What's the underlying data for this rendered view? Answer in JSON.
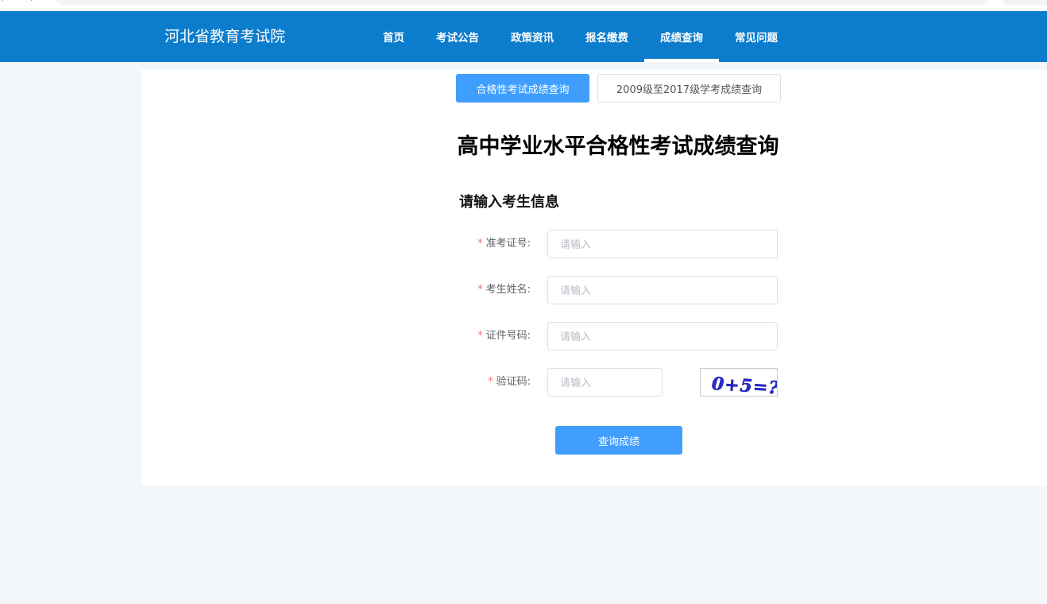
{
  "header": {
    "site_title": "河北省教育考试院",
    "nav": [
      {
        "label": "首页",
        "active": false
      },
      {
        "label": "考试公告",
        "active": false
      },
      {
        "label": "政策资讯",
        "active": false
      },
      {
        "label": "报名缴费",
        "active": false
      },
      {
        "label": "成绩查询",
        "active": true
      },
      {
        "label": "常见问题",
        "active": false
      }
    ]
  },
  "tabs": {
    "primary_label": "合格性考试成绩查询",
    "secondary_label": "2009级至2017级学考成绩查询"
  },
  "main": {
    "title": "高中学业水平合格性考试成绩查询",
    "section_title": "请输入考生信息"
  },
  "form": {
    "required_mark": "*",
    "fields": [
      {
        "label": "准考证号:",
        "placeholder": "请输入",
        "value": ""
      },
      {
        "label": "考生姓名:",
        "placeholder": "请输入",
        "value": ""
      },
      {
        "label": "证件号码:",
        "placeholder": "请输入",
        "value": ""
      },
      {
        "label": "验证码:",
        "placeholder": "请输入",
        "value": ""
      }
    ],
    "captcha_text": "0+5=?",
    "submit_label": "查询成绩"
  },
  "colors": {
    "header_bg": "#0c7ccd",
    "primary": "#409eff",
    "required": "#f56c6c",
    "captcha_ink": "#2a2ad0"
  }
}
